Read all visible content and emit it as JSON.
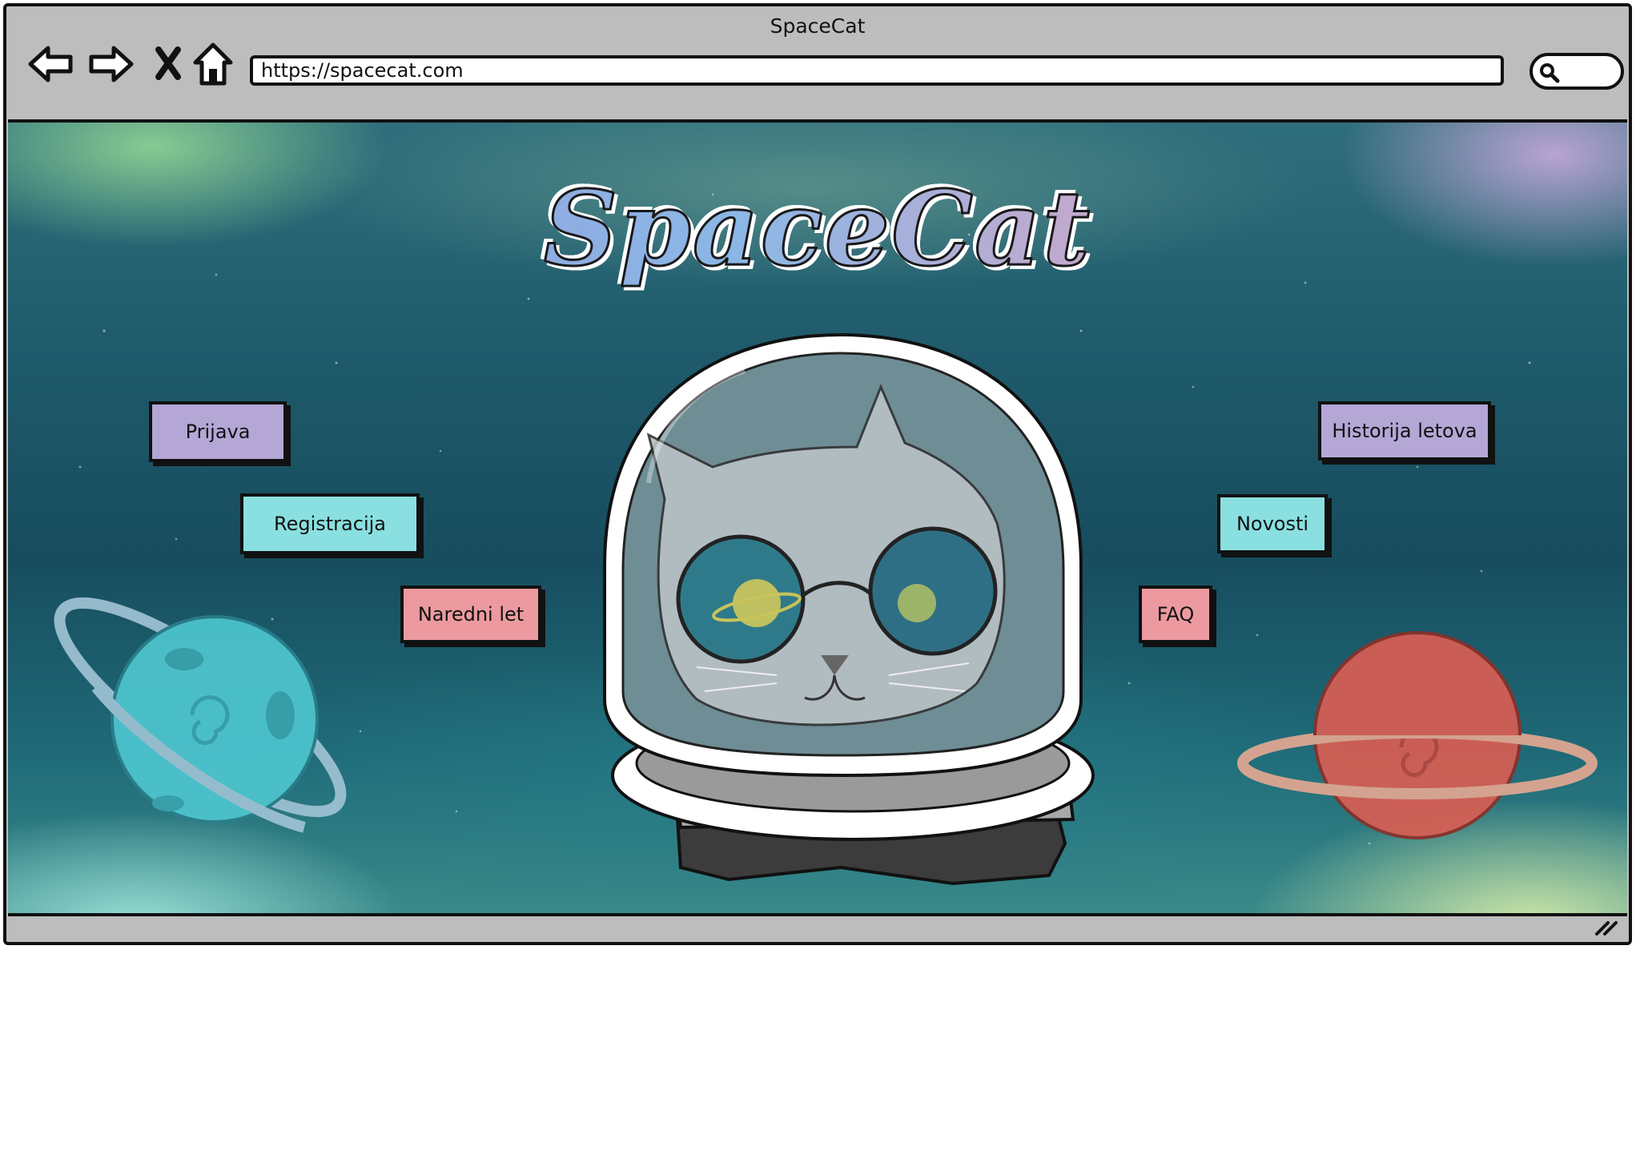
{
  "browser": {
    "title": "SpaceCat",
    "url": "https://spacecat.com"
  },
  "logo": {
    "text": "SpaceCat"
  },
  "menu_left": [
    {
      "label": "Prijava",
      "color": "#b4a7d6"
    },
    {
      "label": "Registracija",
      "color": "#8adfe0"
    },
    {
      "label": "Naredni let",
      "color": "#ec9aa0"
    }
  ],
  "menu_right": [
    {
      "label": "Historija letova",
      "color": "#b4a7d6"
    },
    {
      "label": "Novosti",
      "color": "#8adfe0"
    },
    {
      "label": "FAQ",
      "color": "#ec9aa0"
    }
  ],
  "icons": [
    "back-arrow-icon",
    "forward-arrow-icon",
    "close-icon",
    "home-icon",
    "search-icon",
    "resize-grip-icon"
  ]
}
